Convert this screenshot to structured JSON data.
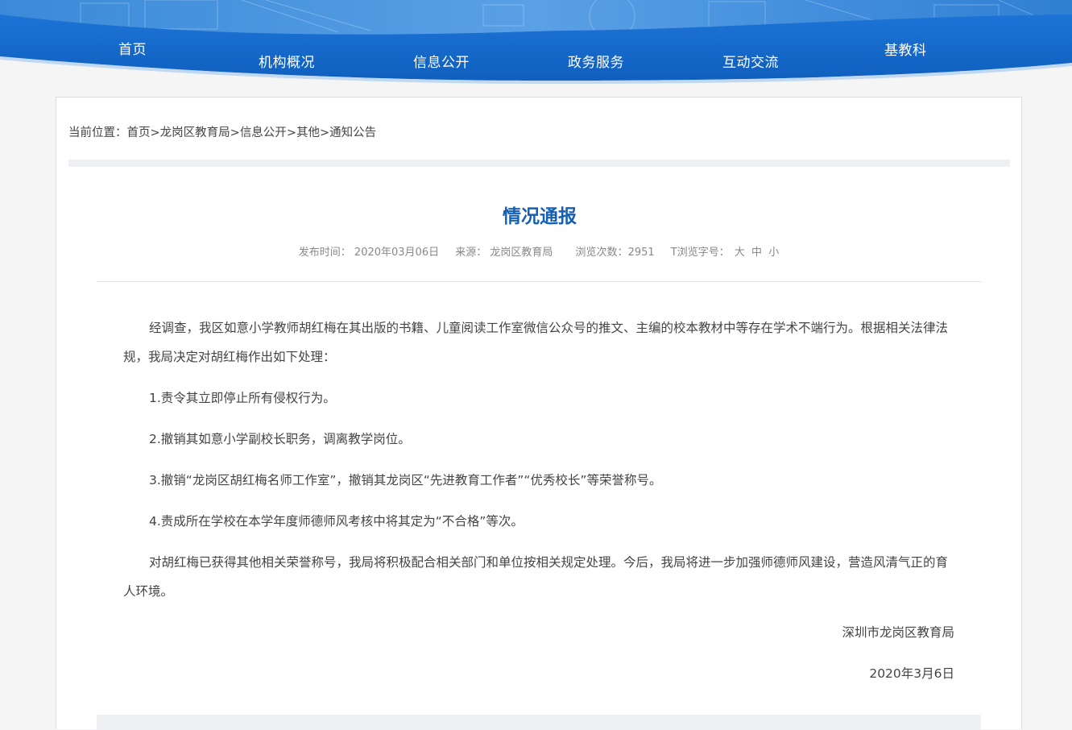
{
  "nav": {
    "items": [
      {
        "label": "首页"
      },
      {
        "label": "机构概况"
      },
      {
        "label": "信息公开"
      },
      {
        "label": "政务服务"
      },
      {
        "label": "互动交流"
      },
      {
        "label": "基教科"
      }
    ]
  },
  "breadcrumb": {
    "prefix": "当前位置：",
    "links": [
      "首页",
      "龙岗区教育局",
      "信息公开",
      "其他",
      "通知公告"
    ],
    "separator": ">"
  },
  "article": {
    "title": "情况通报",
    "meta": {
      "publish_label": "发布时间：",
      "publish_value": "2020年03月06日",
      "source_label": "来源：",
      "source_value": "龙岗区教育局",
      "views_label": "浏览次数：",
      "views_value": "2951",
      "fontsize_label": "T浏览字号：",
      "size_large": "大",
      "size_medium": "中",
      "size_small": "小"
    },
    "paragraphs": [
      "经调查，我区如意小学教师胡红梅在其出版的书籍、儿童阅读工作室微信公众号的推文、主编的校本教材中等存在学术不端行为。根据相关法律法规，我局决定对胡红梅作出如下处理：",
      "1.责令其立即停止所有侵权行为。",
      "2.撤销其如意小学副校长职务，调离教学岗位。",
      "3.撤销“龙岗区胡红梅名师工作室”，撤销其龙岗区“先进教育工作者”“优秀校长”等荣誉称号。",
      "4.责成所在学校在本学年度师德师风考核中将其定为“不合格”等次。",
      "对胡红梅已获得其他相关荣誉称号，我局将积极配合相关部门和单位按相关规定处理。今后，我局将进一步加强师德师风建设，营造风清气正的育人环境。"
    ],
    "signature": "深圳市龙岗区教育局",
    "date": "2020年3月6日"
  },
  "colors": {
    "nav_blue": "#1a6dd0",
    "title_blue": "#1560b5"
  }
}
